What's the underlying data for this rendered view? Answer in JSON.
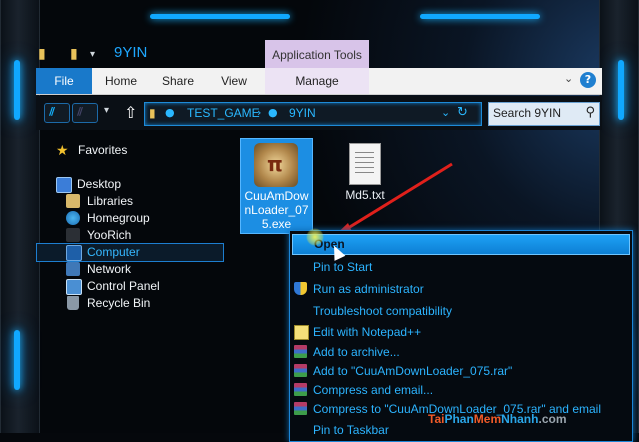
{
  "window": {
    "title": "9YIN",
    "contextual_tab_group": "Application Tools"
  },
  "ribbon": {
    "tabs": [
      {
        "label": "File"
      },
      {
        "label": "Home"
      },
      {
        "label": "Share"
      },
      {
        "label": "View"
      },
      {
        "label": "Manage"
      }
    ]
  },
  "address": {
    "segments": [
      "TEST_GAME",
      "9YIN"
    ],
    "search_placeholder": "Search 9YIN"
  },
  "nav_pane": {
    "favorites": "Favorites",
    "items": [
      {
        "label": "Desktop"
      },
      {
        "label": "Libraries"
      },
      {
        "label": "Homegroup"
      },
      {
        "label": "YooRich"
      },
      {
        "label": "Computer"
      },
      {
        "label": "Network"
      },
      {
        "label": "Control Panel"
      },
      {
        "label": "Recycle Bin"
      }
    ],
    "selected": "Computer"
  },
  "files": [
    {
      "name": "CuuAmDownLoader_075.exe",
      "selected": true
    },
    {
      "name": "Md5.txt",
      "selected": false
    }
  ],
  "context_menu": {
    "items": [
      {
        "label": "Open",
        "icon": "",
        "highlighted": true
      },
      {
        "label": "Pin to Start",
        "icon": ""
      },
      {
        "label": "Run as administrator",
        "icon": "uac-shield-icon"
      },
      {
        "label": "Troubleshoot compatibility",
        "icon": ""
      },
      {
        "label": "Edit with Notepad++",
        "icon": "notepad-plus-plus-icon"
      },
      {
        "label": "Add to archive...",
        "icon": "winrar-icon"
      },
      {
        "label": "Add to \"CuuAmDownLoader_075.rar\"",
        "icon": "winrar-icon"
      },
      {
        "label": "Compress and email...",
        "icon": "winrar-icon"
      },
      {
        "label": "Compress to \"CuuAmDownLoader_075.rar\" and email",
        "icon": "winrar-icon"
      },
      {
        "label": "Pin to Taskbar",
        "icon": ""
      }
    ]
  },
  "watermark": {
    "part1": "Tai",
    "part2": "Phan",
    "part3": "Mem",
    "part4": "Nhanh",
    "part5": ".com"
  },
  "colors": {
    "accent": "#1ea7ff",
    "file_tab": "#1979ca",
    "contextual_tab": "#d8c4e9",
    "annotation_arrow": "#e0201b"
  }
}
